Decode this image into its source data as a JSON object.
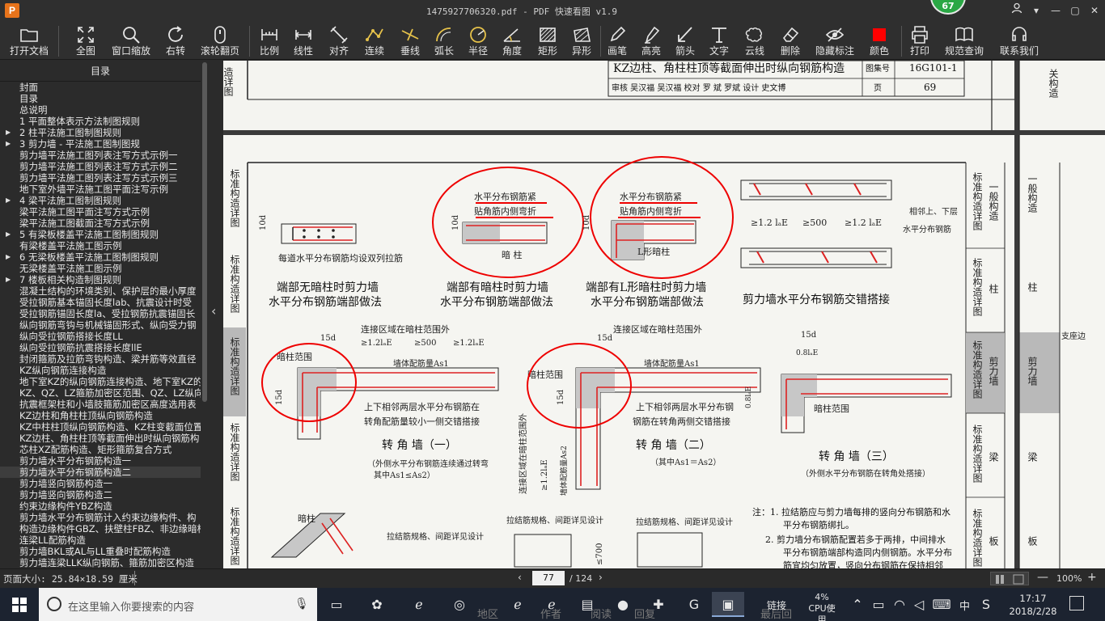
{
  "app": {
    "icon_letter": "P",
    "window_title": "1475927706320.pdf - PDF 快速看图 v1.9",
    "badge": "67"
  },
  "window_controls": {
    "user": "user-icon",
    "dropdown": "▾",
    "minimize": "—",
    "restore": "▢",
    "close": "✕"
  },
  "toolbar": [
    {
      "label": "打开文档",
      "icon": "folder-icon"
    },
    {
      "label": "全图",
      "icon": "fit-all-icon"
    },
    {
      "label": "窗口缩放",
      "icon": "zoom-window-icon"
    },
    {
      "label": "右转",
      "icon": "rotate-right-icon"
    },
    {
      "label": "滚轮翻页",
      "icon": "mouse-wheel-icon"
    },
    {
      "label": "比例",
      "icon": "scale-icon"
    },
    {
      "label": "线性",
      "icon": "linear-dim-icon"
    },
    {
      "label": "对齐",
      "icon": "aligned-dim-icon"
    },
    {
      "label": "连续",
      "icon": "continuous-dim-icon"
    },
    {
      "label": "垂线",
      "icon": "perpendicular-icon"
    },
    {
      "label": "弧长",
      "icon": "arc-length-icon"
    },
    {
      "label": "半径",
      "icon": "radius-icon"
    },
    {
      "label": "角度",
      "icon": "angle-icon"
    },
    {
      "label": "矩形",
      "icon": "rectangle-icon"
    },
    {
      "label": "异形",
      "icon": "polygon-icon"
    },
    {
      "label": "画笔",
      "icon": "pen-icon"
    },
    {
      "label": "高亮",
      "icon": "highlighter-icon"
    },
    {
      "label": "箭头",
      "icon": "arrow-icon"
    },
    {
      "label": "文字",
      "icon": "text-icon"
    },
    {
      "label": "云线",
      "icon": "cloud-line-icon"
    },
    {
      "label": "删除",
      "icon": "eraser-icon"
    },
    {
      "label": "隐藏标注",
      "icon": "hide-eye-icon"
    },
    {
      "label": "颜色",
      "icon": "color-swatch-icon",
      "color": "#ff0000"
    },
    {
      "label": "打印",
      "icon": "printer-icon"
    },
    {
      "label": "规范查询",
      "icon": "spec-book-icon"
    },
    {
      "label": "联系我们",
      "icon": "headset-icon"
    }
  ],
  "toc": {
    "header": "目录",
    "items": [
      {
        "label": "封面",
        "indent": 1,
        "arrow": false
      },
      {
        "label": "目录",
        "indent": 1,
        "arrow": false
      },
      {
        "label": "总说明",
        "indent": 1,
        "arrow": false
      },
      {
        "label": "1 平面整体表示方法制图规则",
        "indent": 1,
        "arrow": false
      },
      {
        "label": "2 柱平法施工图制图规则",
        "indent": 1,
        "arrow": true
      },
      {
        "label": "3 剪力墙 - 平法施工图制图规",
        "indent": 1,
        "arrow": true
      },
      {
        "label": "剪力墙平法施工图列表注写方式示例一",
        "indent": 2,
        "arrow": false
      },
      {
        "label": "剪力墙平法施工图列表注写方式示例二",
        "indent": 2,
        "arrow": false
      },
      {
        "label": "剪力墙平法施工图列表注写方式示例三",
        "indent": 2,
        "arrow": false
      },
      {
        "label": "地下室外墙平法施工图平面注写示例",
        "indent": 2,
        "arrow": false
      },
      {
        "label": "4 梁平法施工图制图规则",
        "indent": 1,
        "arrow": true
      },
      {
        "label": "梁平法施工图平面注写方式示例",
        "indent": 1,
        "arrow": false
      },
      {
        "label": "梁平法施工图截面注写方式示例",
        "indent": 1,
        "arrow": false
      },
      {
        "label": "5 有梁板楼盖平法施工图制图规则",
        "indent": 1,
        "arrow": true
      },
      {
        "label": "有梁楼盖平法施工图示例",
        "indent": 1,
        "arrow": false
      },
      {
        "label": "6 无梁板楼盖平法施工图制图规则",
        "indent": 1,
        "arrow": true
      },
      {
        "label": "无梁楼盖平法施工图示例",
        "indent": 1,
        "arrow": false
      },
      {
        "label": "7 楼板相关构造制图规则",
        "indent": 1,
        "arrow": true
      },
      {
        "label": "混凝土结构的环境类别、保护层的最小厚度",
        "indent": 1,
        "arrow": false
      },
      {
        "label": "受拉钢筋基本锚固长度lab、抗震设计时受",
        "indent": 1,
        "arrow": false
      },
      {
        "label": "受拉钢筋锚固长度la、受拉钢筋抗震锚固长",
        "indent": 1,
        "arrow": false
      },
      {
        "label": "纵向钢筋弯钩与机械锚固形式、纵向受力钢",
        "indent": 1,
        "arrow": false
      },
      {
        "label": "纵向受拉钢筋搭接长度LL",
        "indent": 1,
        "arrow": false
      },
      {
        "label": "纵向受拉钢筋抗震搭接长度llE",
        "indent": 1,
        "arrow": false
      },
      {
        "label": "封闭箍筋及拉筋弯钩构造、梁并筋等效直径",
        "indent": 1,
        "arrow": false
      },
      {
        "label": "KZ纵向钢筋连接构造",
        "indent": 1,
        "arrow": false
      },
      {
        "label": "地下室KZ的纵向钢筋连接构造、地下室KZ的",
        "indent": 1,
        "arrow": false
      },
      {
        "label": "KZ、QZ、LZ箍筋加密区范围、QZ、LZ纵向钢",
        "indent": 1,
        "arrow": false
      },
      {
        "label": "抗震框架柱和小墙肢箍筋加密区高度选用表",
        "indent": 1,
        "arrow": false
      },
      {
        "label": "KZ边柱和角柱柱顶纵向钢筋构造",
        "indent": 1,
        "arrow": false
      },
      {
        "label": "KZ中柱柱顶纵向钢筋构造、KZ柱变截面位置",
        "indent": 1,
        "arrow": false
      },
      {
        "label": "KZ边柱、角柱柱顶等截面伸出时纵向钢筋构",
        "indent": 1,
        "arrow": false
      },
      {
        "label": "芯柱XZ配筋构造、矩形箍筋复合方式",
        "indent": 1,
        "arrow": false
      },
      {
        "label": "剪力墙水平分布钢筋构造一",
        "indent": 1,
        "arrow": false
      },
      {
        "label": "剪力墙水平分布钢筋构造二",
        "indent": 1,
        "arrow": false,
        "selected": true
      },
      {
        "label": "剪力墙竖向钢筋构造一",
        "indent": 1,
        "arrow": false
      },
      {
        "label": "剪力墙竖向钢筋构造二",
        "indent": 1,
        "arrow": false
      },
      {
        "label": "约束边缘构件YBZ构造",
        "indent": 1,
        "arrow": false
      },
      {
        "label": "剪力墙水平分布钢筋计入约束边缘构件、构",
        "indent": 1,
        "arrow": false
      },
      {
        "label": "构造边缘构件GBZ、扶壁柱FBZ、非边缘暗柱",
        "indent": 1,
        "arrow": false
      },
      {
        "label": "连梁LL配筋构造",
        "indent": 1,
        "arrow": false
      },
      {
        "label": "剪力墙BKL或AL与LL重叠时配筋构造",
        "indent": 1,
        "arrow": false
      },
      {
        "label": "剪力墙连梁LLK纵向钢筋、箍筋加密区构造",
        "indent": 1,
        "arrow": false
      }
    ]
  },
  "document": {
    "title_block": {
      "title": "KZ边柱、角柱柱顶等截面伸出时纵向钢筋构造",
      "atlas_label": "图集号",
      "atlas_no": "16G101-1",
      "page_label": "页",
      "page_no": "69",
      "signers": "审核 吴汉福 吴汉福 校对 罗 斌 罗斌 设计 史文博"
    },
    "prev_side_tab": "造详图",
    "right_col_prev": "关构造",
    "side_tabs": [
      {
        "vertical": "标准构造详图",
        "cat": "一般构造"
      },
      {
        "vertical": "标准构造详图",
        "cat": "柱"
      },
      {
        "vertical": "标准构造详图",
        "cat": "剪力墙",
        "active": true
      },
      {
        "vertical": "标准构造详图",
        "cat": "梁"
      },
      {
        "vertical": "标准构造详图",
        "cat": "板"
      }
    ],
    "right_col_cats": [
      "一般构造",
      "柱",
      "剪力墙",
      "梁",
      "板"
    ],
    "right_col_note": "支座边",
    "texts": {
      "ann1a": "水平分布钢筋紧",
      "ann1b": "贴角筋内侧弯折",
      "ann2a": "水平分布钢筋紧",
      "ann2b": "贴角筋内侧弯折",
      "dim_10d_a": "10d",
      "dim_10d_b": "10d",
      "dim_10d_c": "10d",
      "each_layer_note": "每道水平分布钢筋均设双列拉筋",
      "hidden_col": "暗 柱",
      "l_hidden_col": "L形暗柱",
      "adj_note1": "相邻上、下层",
      "adj_note2": "水平分布钢筋",
      "lap1": "≥1.2 lₐE",
      "lap2": "≥500",
      "lap3": "≥1.2 lₐE",
      "cap1a": "端部无暗柱时剪力墙",
      "cap1b": "水平分布钢筋端部做法",
      "cap2a": "端部有暗柱时剪力墙",
      "cap2b": "水平分布钢筋端部做法",
      "cap3a": "端部有L形暗柱时剪力墙",
      "cap3b": "水平分布钢筋端部做法",
      "cap4": "剪力墙水平分布钢筋交错搭接",
      "dim_15d_a": "15d",
      "dim_15d_b": "15d",
      "dim_15d_c": "15d",
      "dim_15d_d": "15d",
      "dim_15d_e": "15d",
      "dim_08lae_a": "0.8lₐE",
      "dim_08lae_b": "0.8lₐE",
      "conn_zone_a": "连接区域在暗柱范围外",
      "conn_zone_b": "连接区域在暗柱范围外",
      "conn_zone_v": "连接区域在暗柱范围外",
      "lap_a1": "≥1.2lₐE",
      "lap_a2": "≥500",
      "lap_a3": "≥1.2lₐE",
      "lap_v": "≥1.2lₐE",
      "col_range_a": "暗柱范围",
      "col_range_b": "暗柱范围",
      "col_range_c": "暗柱范围",
      "wall_rebar_a": "墙体配筋量As1",
      "wall_rebar_b": "墙体配筋量As1",
      "wall_rebar_v": "墙体配筋量As2",
      "corner1_note_a": "上下相邻两层水平分布钢筋在",
      "corner1_note_b": "转角配筋量较小一侧交错搭接",
      "corner2_note_a": "上下相邻两层水平分布钢",
      "corner2_note_b": "钢筋在转角两侧交错搭接",
      "corner1_title": "转 角 墙（一）",
      "corner1_sub_a": "（外侧水平分布钢筋连续通过转弯",
      "corner1_sub_b": "其中As1≤As2）",
      "corner2_title": "转 角 墙（二）",
      "corner2_sub": "（其中As1＝As2）",
      "corner3_title": "转 角 墙（三）",
      "corner3_sub": "（外侧水平分布钢筋在转角处搭接）",
      "tie_spec_a": "拉结筋规格、间距详见设计",
      "tie_spec_b": "拉结筋规格、间距详见设计",
      "tie_spec_c": "拉结筋规格、间距详见设计",
      "lower_hidden_col": "暗柱",
      "dim_700": "≤700",
      "note_head": "注：1. 拉结筋应与剪力墙每排的竖向分布钢筋和水",
      "note_l2": "平分布钢筋绑扎。",
      "note_l3": "2. 剪力墙分布钢筋配置若多于两排，中间排水",
      "note_l4": "平分布钢筋端部构造同内侧钢筋。水平分布",
      "note_l5": "筋宜均匀放置，竖向分布钢筋在保持相邻"
    }
  },
  "statusbar": {
    "page_size": "页面大小: 25.84×18.59 厘米",
    "current_page": "77",
    "total_pages": "/ 124",
    "prev": "‹",
    "next": "›",
    "zoom": "100%",
    "zoom_out": "—",
    "zoom_in": "+"
  },
  "taskbar": {
    "search_placeholder": "在这里输入你要搜索的内容",
    "ghost_left": "地区",
    "ghost_mid1": "作者",
    "ghost_mid2": "阅读",
    "ghost_mid3": "回复",
    "ghost_right": "最后回",
    "link_label": "链接",
    "cpu_percent": "4%",
    "cpu_label": "CPU使用",
    "ime": "中",
    "time": "17:17",
    "date": "2018/2/28"
  }
}
